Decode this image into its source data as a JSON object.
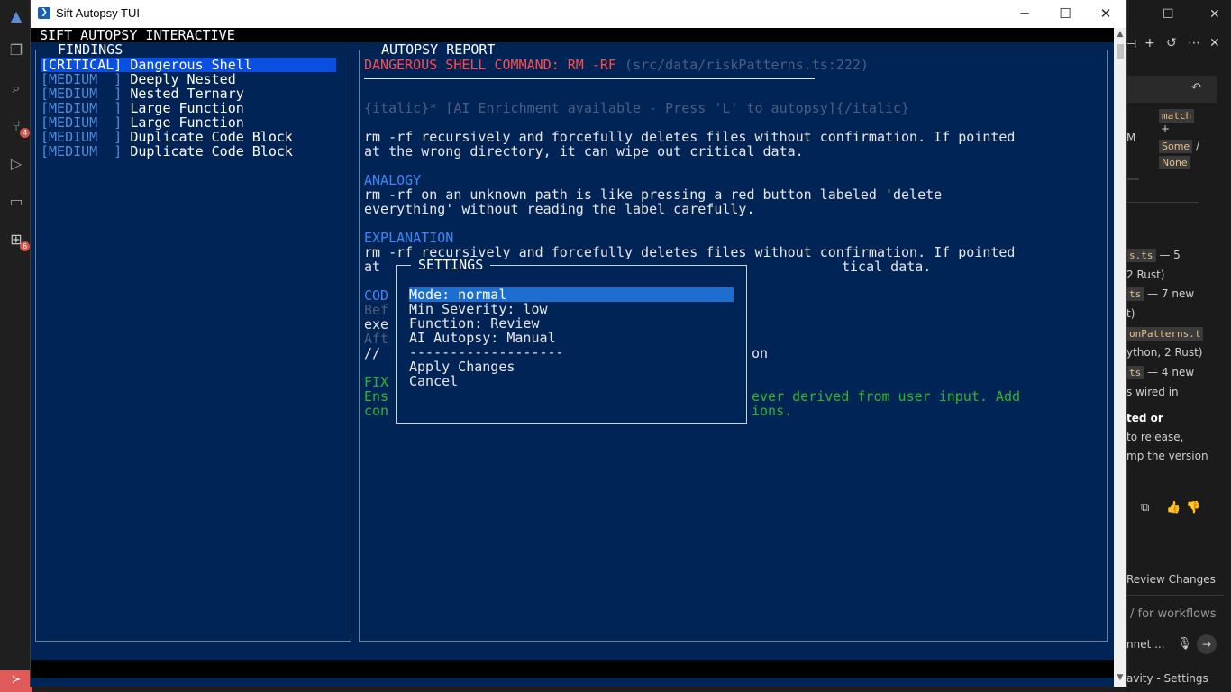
{
  "window": {
    "title": "Sift Autopsy TUI",
    "minimize": "─",
    "maximize": "☐",
    "close": "✕"
  },
  "header": {
    "text": "SIFT AUTOPSY INTERACTIVE"
  },
  "findings": {
    "title": "FINDINGS",
    "items": [
      {
        "severity": "[CRITICAL]",
        "name": "Dangerous Shell",
        "selected": true
      },
      {
        "severity": "[MEDIUM  ]",
        "name": "Deeply Nested"
      },
      {
        "severity": "[MEDIUM  ]",
        "name": "Nested Ternary"
      },
      {
        "severity": "[MEDIUM  ]",
        "name": "Large Function"
      },
      {
        "severity": "[MEDIUM  ]",
        "name": "Large Function"
      },
      {
        "severity": "[MEDIUM  ]",
        "name": "Duplicate Code Block"
      },
      {
        "severity": "[MEDIUM  ]",
        "name": "Duplicate Code Block"
      }
    ]
  },
  "report": {
    "title": "AUTOPSY REPORT",
    "heading": "DANGEROUS SHELL COMMAND: RM -RF",
    "location": "(src/data/riskPatterns.ts:222)",
    "enrichment": "{italic}* [AI Enrichment available - Press 'L' to autopsy]{/italic}",
    "summary_1": "rm -rf recursively and forcefully deletes files without confirmation. If pointed",
    "summary_2": "at the wrong directory, it can wipe out critical data.",
    "analogy_label": "ANALOGY",
    "analogy_1": "rm -rf on an unknown path is like pressing a red button labeled 'delete",
    "analogy_2": "everything' without reading the label carefully.",
    "explanation_label": "EXPLANATION",
    "explanation_1": "rm -rf recursively and forcefully deletes files without confirmation. If pointed",
    "explanation_2a": "at",
    "explanation_2b": "tical data.",
    "code_label": "COD",
    "code_before": "Bef",
    "code_exe": "exe",
    "code_after": "Aft",
    "code_comment": "//",
    "code_comment_tail": "on",
    "fix_label": "FIX",
    "fix_1a": "Ens",
    "fix_1b": "ever derived from user input. Add",
    "fix_2a": "con",
    "fix_2b": "ions."
  },
  "settings": {
    "title": "SETTINGS",
    "mode": "Mode: normal",
    "severity": "Min Severity: low",
    "function": "Function: Review",
    "ai": "AI Autopsy: Manual",
    "divider": "-------------------",
    "apply": "Apply Changes",
    "cancel": "Cancel"
  },
  "right_panel": {
    "match": "match",
    "plus": "+",
    "some": "Some",
    "slash": "/",
    "none": "None",
    "m_char": "M",
    "file1": "s.ts",
    "file1_tail": "— 5",
    "rust1": "2 Rust)",
    "file2": "ts",
    "file2_tail": "— 7 new",
    "paren": "t)",
    "file3": "onPatterns.t",
    "python": "ython, 2 Rust)",
    "file4": "ts",
    "file4_tail": "— 4 new",
    "wired": "s wired in",
    "bold": "ted or",
    "release": "to release,",
    "bump": "mp the version",
    "review": "Review Changes",
    "workflows": "/ for workflows",
    "sonnet": "nnet ...",
    "footer": "avity - Settings"
  },
  "activity_badges": {
    "scm": "4",
    "ext": "6"
  },
  "colors": {
    "terminal_bg": "#012456",
    "selection": "#0b4fe0",
    "critical": "#ff4d4d",
    "accent": "#3f88f5",
    "fix": "#2fb52f"
  }
}
